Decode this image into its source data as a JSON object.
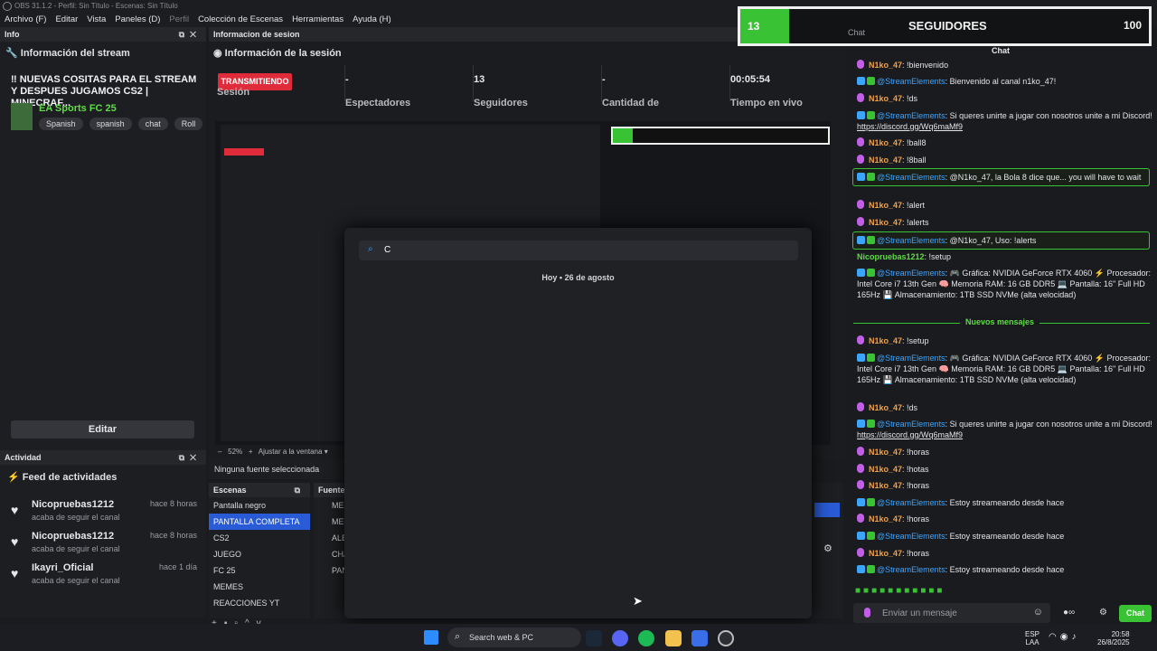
{
  "window": {
    "title": "OBS 31.1.2 - Perfil: Sin Título - Escenas: Sin Título"
  },
  "menu": [
    "Archivo (F)",
    "Editar",
    "Vista",
    "Paneles (D)",
    "Perfil",
    "Colección de Escenas",
    "Herramientas",
    "Ayuda (H)"
  ],
  "info_panel": {
    "header": "Info",
    "section_title": "Información del stream",
    "stream_title": "‼ NUEVAS COSITAS PARA EL STREAM Y DESPUES JUGAMOS CS2 | MINECRAF...",
    "game": "EA Sports FC 25",
    "tags": [
      "Spanish",
      "spanish",
      "chat",
      "Roll"
    ],
    "edit_button": "Editar"
  },
  "activity_panel": {
    "header": "Actividad",
    "title": "Feed de actividades",
    "items": [
      {
        "name": "Nicopruebas1212",
        "action": "acaba de seguir el canal",
        "time": "hace 8 horas"
      },
      {
        "name": "Nicopruebas1212",
        "action": "acaba de seguir el canal",
        "time": "hace 8 horas"
      },
      {
        "name": "Ikayri_Oficial",
        "action": "acaba de seguir el canal",
        "time": "hace 1 día"
      }
    ]
  },
  "session_panel": {
    "header": "Informacion de sesion",
    "title": "Información de la sesión",
    "status_badge": "TRANSMITIENDO",
    "stats": [
      {
        "value": "",
        "label": "Sesión"
      },
      {
        "value": "-",
        "label": "Espectadores"
      },
      {
        "value": "13",
        "label": "Seguidores"
      },
      {
        "value": "-",
        "label": "Cantidad de"
      },
      {
        "value": "00:05:54",
        "label": "Tiempo en vivo"
      }
    ],
    "zoom": "52%",
    "fit_label": "Ajustar a la ventana",
    "no_source": "Ninguna fuente seleccionada"
  },
  "overlay": {
    "count_left": "13",
    "label": "SEGUIDORES",
    "count_right": "100",
    "chat_caption": "Chat"
  },
  "scenes": {
    "header": "Escenas",
    "items": [
      "Pantalla negro",
      "PANTALLA COMPLETA",
      "CS2",
      "JUEGO",
      "FC 25",
      "MEMES",
      "REACCIONES YT"
    ],
    "selected_index": 1
  },
  "sources": {
    "header": "Fuentes",
    "items": [
      "MEM",
      "MET",
      "ALE",
      "CHA",
      "PAN"
    ]
  },
  "search_popup": {
    "query": "C",
    "date_label": "Hoy",
    "date_value": "26 de agosto"
  },
  "chat_panel": {
    "header": "Chat",
    "new_messages": "Nuevos mensajes",
    "input_placeholder": "Enviar un mensaje",
    "send_button": "Chat",
    "messages": [
      {
        "user": "N1ko_47",
        "text": ": !bienvenido"
      },
      {
        "user": "@StreamElements",
        "text": ": Bienvenido al canal n1ko_47!"
      },
      {
        "user": "N1ko_47",
        "text": ": !ds"
      },
      {
        "user": "@StreamElements",
        "text": ": Si queres unirte a jugar con nosotros unite a mi Discord! ",
        "link": "https://discord.gg/Wq6maMf9"
      },
      {
        "user": "N1ko_47",
        "text": ": !ball8"
      },
      {
        "user": "N1ko_47",
        "text": ": !8ball"
      },
      {
        "user": "@StreamElements",
        "text": ": @N1ko_47, la Bola 8 dice que... you will have to wait"
      },
      {
        "user": "N1ko_47",
        "text": ": !alert"
      },
      {
        "user": "N1ko_47",
        "text": ": !alerts"
      },
      {
        "user": "@StreamElements",
        "text": ": @N1ko_47, Uso: !alerts"
      },
      {
        "user": "Nicopruebas1212",
        "text": ": !setup"
      },
      {
        "user": "@StreamElements",
        "text": ": 🎮 Gráfica: NVIDIA GeForce RTX 4060 ⚡ Procesador: Intel Core i7 13th Gen 🧠 Memoria RAM: 16 GB DDR5 💻 Pantalla: 16\" Full HD 165Hz 💾 Almacenamiento: 1TB SSD NVMe (alta velocidad)"
      },
      {
        "user": "N1ko_47",
        "text": ": !setup"
      },
      {
        "user": "@StreamElements",
        "text": ": 🎮 Gráfica: NVIDIA GeForce RTX 4060 ⚡ Procesador: Intel Core i7 13th Gen 🧠 Memoria RAM: 16 GB DDR5 💻 Pantalla: 16\" Full HD 165Hz 💾 Almacenamiento: 1TB SSD NVMe (alta velocidad)"
      },
      {
        "user": "N1ko_47",
        "text": ": !ds"
      },
      {
        "user": "@StreamElements",
        "text": ": Si queres unirte a jugar con nosotros unite a mi Discord! ",
        "link": "https://discord.gg/Wq6maMf9"
      },
      {
        "user": "N1ko_47",
        "text": ": !horas"
      },
      {
        "user": "N1ko_47",
        "text": ": !hotas"
      },
      {
        "user": "N1ko_47",
        "text": ": !horas"
      },
      {
        "user": "@StreamElements",
        "text": ": Estoy streameando desde hace"
      },
      {
        "user": "N1ko_47",
        "text": ": !horas"
      },
      {
        "user": "@StreamElements",
        "text": ": Estoy streameando desde hace"
      },
      {
        "user": "N1ko_47",
        "text": ": !horas"
      },
      {
        "user": "@StreamElements",
        "text": ": Estoy streameando desde hace"
      }
    ]
  },
  "taskbar": {
    "search_placeholder": "Search web & PC",
    "language": "ESP",
    "layout": "LAA",
    "time": "20:58",
    "date": "26/8/2025"
  },
  "colors": {
    "accent": "#2a5bd7",
    "live": "#e02b3a",
    "green": "#39c234",
    "streamelements": "#3ba5ff",
    "user": "#f0a24b"
  }
}
